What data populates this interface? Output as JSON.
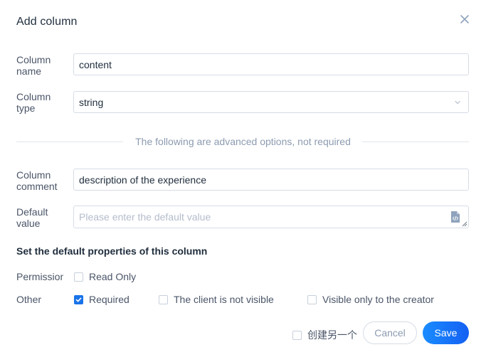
{
  "dialog": {
    "title": "Add column"
  },
  "fields": {
    "column_name": {
      "label_line1": "Column",
      "label_line2": "name",
      "value": "content"
    },
    "column_type": {
      "label_line1": "Column",
      "label_line2": "type",
      "value": "string"
    },
    "advanced_divider": "The following are advanced options, not required",
    "column_comment": {
      "label_line1": "Column",
      "label_line2": "comment",
      "value": "description of the experience"
    },
    "default_value": {
      "label_line1": "Default",
      "label_line2": "value",
      "placeholder": "Please enter the default value"
    }
  },
  "properties": {
    "title": "Set the default properties of this column",
    "permissions_label": "Permissions",
    "other_label": "Other",
    "read_only": {
      "label": "Read Only",
      "checked": false
    },
    "required": {
      "label": "Required",
      "checked": true
    },
    "client_not_visible": {
      "label": "The client is not visible",
      "checked": false
    },
    "visible_creator_only": {
      "label": "Visible only to the creator",
      "checked": false
    }
  },
  "footer": {
    "create_another": {
      "label": "创建另一个",
      "checked": false
    },
    "cancel_label": "Cancel",
    "save_label": "Save"
  },
  "colors": {
    "primary": "#1a73e8",
    "text": "#4a5568",
    "heading": "#1f2d3d",
    "muted": "#8c9bb0"
  },
  "icons": {
    "close": "close-icon",
    "select": "chevron-down-icon",
    "code_editor": "code-file-icon",
    "check": "check-icon"
  }
}
